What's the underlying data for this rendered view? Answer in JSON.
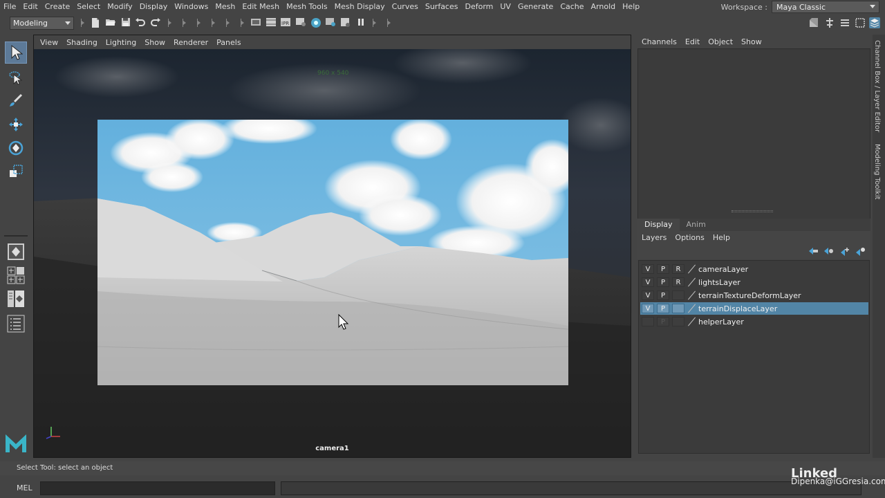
{
  "menubar": {
    "items": [
      "File",
      "Edit",
      "Create",
      "Select",
      "Modify",
      "Display",
      "Windows",
      "Mesh",
      "Edit Mesh",
      "Mesh Tools",
      "Mesh Display",
      "Curves",
      "Surfaces",
      "Deform",
      "UV",
      "Generate",
      "Cache",
      "Arnold",
      "Help"
    ]
  },
  "workspace": {
    "label": "Workspace :",
    "value": "Maya Classic"
  },
  "statusline": {
    "mode": "Modeling"
  },
  "viewport": {
    "menus": [
      "View",
      "Shading",
      "Lighting",
      "Show",
      "Renderer",
      "Panels"
    ],
    "camera_label": "camera1",
    "resolution": "960 x 540"
  },
  "channelbox": {
    "menus": [
      "Channels",
      "Edit",
      "Object",
      "Show"
    ]
  },
  "layer_editor": {
    "tabs": [
      "Display",
      "Anim"
    ],
    "active_tab": "Display",
    "menus": [
      "Layers",
      "Options",
      "Help"
    ],
    "layers": [
      {
        "v": "V",
        "p": "P",
        "r": "R",
        "name": "cameraLayer",
        "selected": false
      },
      {
        "v": "V",
        "p": "P",
        "r": "R",
        "name": "lightsLayer",
        "selected": false
      },
      {
        "v": "V",
        "p": "P",
        "r": "",
        "name": "terrainTextureDeformLayer",
        "selected": false
      },
      {
        "v": "V",
        "p": "P",
        "r": "",
        "name": "terrainDisplaceLayer",
        "selected": true
      },
      {
        "v": "",
        "p": "P",
        "r": "",
        "name": "helperLayer",
        "selected": false
      }
    ]
  },
  "side_tabs": [
    "Channel Box / Layer Editor",
    "Modeling Toolkit"
  ],
  "helpline": {
    "text": "Select Tool: select an object"
  },
  "cmdline": {
    "label": "MEL"
  },
  "watermark": {
    "brand": "Linked",
    "site": "Dipenka@iGGresia.com"
  },
  "colors": {
    "accent": "#5285a6",
    "active_tool": "#5d7a98"
  }
}
